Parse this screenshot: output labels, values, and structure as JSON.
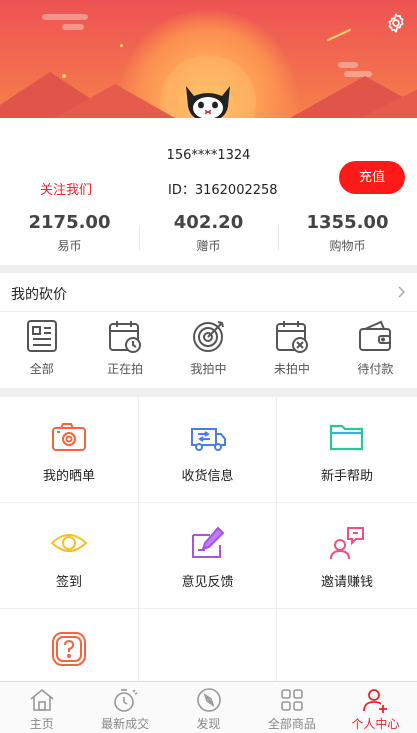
{
  "user": {
    "phone": "156****1324",
    "follow_label": "关注我们",
    "id_text": "ID：3162002258",
    "recharge_label": "充值"
  },
  "stats": [
    {
      "value": "2175.00",
      "label": "易币"
    },
    {
      "value": "402.20",
      "label": "赠币"
    },
    {
      "value": "1355.00",
      "label": "购物币"
    }
  ],
  "bargain": {
    "title": "我的砍价",
    "items": [
      {
        "label": "全部",
        "icon": "list-icon"
      },
      {
        "label": "正在拍",
        "icon": "calendar-clock-icon"
      },
      {
        "label": "我拍中",
        "icon": "target-icon"
      },
      {
        "label": "未拍中",
        "icon": "calendar-x-icon"
      },
      {
        "label": "待付款",
        "icon": "wallet-icon"
      }
    ]
  },
  "services": [
    {
      "label": "我的晒单",
      "icon": "camera-icon",
      "color": "#f2653f"
    },
    {
      "label": "收货信息",
      "icon": "truck-icon",
      "color": "#4a7de8"
    },
    {
      "label": "新手帮助",
      "icon": "folder-icon",
      "color": "#2bc59a"
    },
    {
      "label": "签到",
      "icon": "eye-icon",
      "color": "#f5c12a"
    },
    {
      "label": "意见反馈",
      "icon": "feedback-pen-icon",
      "color": "#a255e8"
    },
    {
      "label": "邀请赚钱",
      "icon": "invite-chat-icon",
      "color": "#f0507a"
    },
    {
      "label": "",
      "icon": "question-icon",
      "color": "#f2653f"
    }
  ],
  "tabs": [
    {
      "label": "主页",
      "icon": "home-icon",
      "active": false
    },
    {
      "label": "最新成交",
      "icon": "stopwatch-icon",
      "active": false
    },
    {
      "label": "发现",
      "icon": "compass-icon",
      "active": false
    },
    {
      "label": "全部商品",
      "icon": "grid-icon",
      "active": false
    },
    {
      "label": "个人中心",
      "icon": "user-icon",
      "active": true
    }
  ],
  "colors": {
    "accent": "#e8262a",
    "recharge_bg": "#ff1a1a",
    "header_top": "#ee5353",
    "header_bottom": "#f5824a"
  }
}
